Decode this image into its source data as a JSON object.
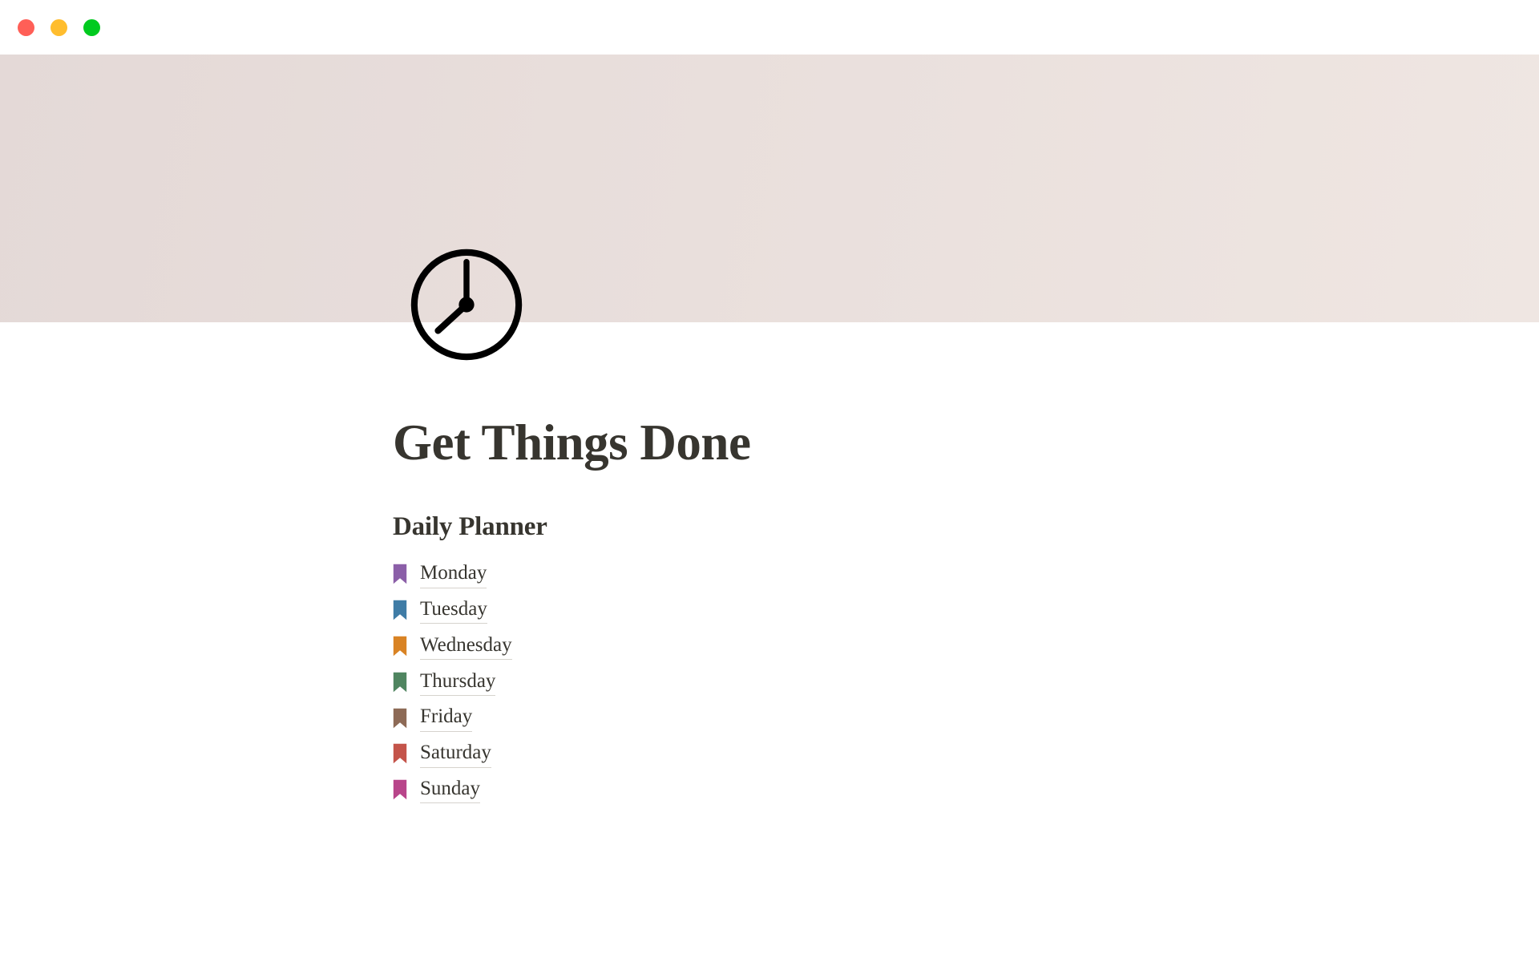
{
  "window": {
    "traffic_lights": [
      {
        "name": "close-button",
        "label": "Close",
        "color": "#ff5f57"
      },
      {
        "name": "minimize-button",
        "label": "Minimize",
        "color": "#ffbd2e"
      },
      {
        "name": "maximize-button",
        "label": "Maximize",
        "color": "#00ca1f"
      }
    ]
  },
  "cover": {
    "icon": "clock-icon",
    "icon_time": "8:00",
    "gradient_start": "#e4d9d7",
    "gradient_end": "#efe6e2"
  },
  "page": {
    "title": "Get Things Done",
    "title_color": "#37352f"
  },
  "section": {
    "heading": "Daily Planner"
  },
  "days": [
    {
      "label": "Monday",
      "icon": "bookmark-icon",
      "color": "#8b5fa8"
    },
    {
      "label": "Tuesday",
      "icon": "bookmark-icon",
      "color": "#3f7ca6"
    },
    {
      "label": "Wednesday",
      "icon": "bookmark-icon",
      "color": "#d98324"
    },
    {
      "label": "Thursday",
      "icon": "bookmark-icon",
      "color": "#4f8560"
    },
    {
      "label": "Friday",
      "icon": "bookmark-icon",
      "color": "#8d6a56"
    },
    {
      "label": "Saturday",
      "icon": "bookmark-icon",
      "color": "#c4544a"
    },
    {
      "label": "Sunday",
      "icon": "bookmark-icon",
      "color": "#b8458a"
    }
  ]
}
